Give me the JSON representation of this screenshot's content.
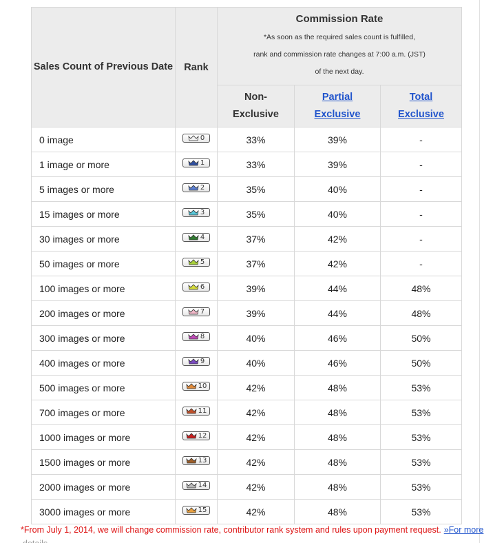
{
  "table": {
    "headers": {
      "sales_count": "Sales Count of Previous Date",
      "rank": "Rank",
      "commission_rate": "Commission Rate",
      "commission_note": [
        "*As soon as the required sales count is fulfilled,",
        "rank and commission rate changes at 7:00 a.m. (JST)",
        "of the next day."
      ],
      "non_exclusive": "Non- Exclusive",
      "partial_exclusive": "Partial Exclusive",
      "total_exclusive": "Total Exclusive"
    },
    "rows": [
      {
        "count": "0 image",
        "rank": "0",
        "rank_color": "#f2f2f2",
        "non_exclusive": "33%",
        "partial": "39%",
        "total": "-"
      },
      {
        "count": "1 image or more",
        "rank": "1",
        "rank_color": "#2f4fa0",
        "non_exclusive": "33%",
        "partial": "39%",
        "total": "-"
      },
      {
        "count": "5 images or more",
        "rank": "2",
        "rank_color": "#5b7fd1",
        "non_exclusive": "35%",
        "partial": "40%",
        "total": "-"
      },
      {
        "count": "15 images or more",
        "rank": "3",
        "rank_color": "#58c6d8",
        "non_exclusive": "35%",
        "partial": "40%",
        "total": "-"
      },
      {
        "count": "30 images or more",
        "rank": "4",
        "rank_color": "#2f7a2f",
        "non_exclusive": "37%",
        "partial": "42%",
        "total": "-"
      },
      {
        "count": "50 images or more",
        "rank": "5",
        "rank_color": "#a8d13a",
        "non_exclusive": "37%",
        "partial": "42%",
        "total": "-"
      },
      {
        "count": "100 images or more",
        "rank": "6",
        "rank_color": "#d6dc3a",
        "non_exclusive": "39%",
        "partial": "44%",
        "total": "48%"
      },
      {
        "count": "200 images or more",
        "rank": "7",
        "rank_color": "#f0b8c8",
        "non_exclusive": "39%",
        "partial": "44%",
        "total": "48%"
      },
      {
        "count": "300 images or more",
        "rank": "8",
        "rank_color": "#c04ab8",
        "non_exclusive": "40%",
        "partial": "46%",
        "total": "50%"
      },
      {
        "count": "400 images or more",
        "rank": "9",
        "rank_color": "#7a4ac0",
        "non_exclusive": "40%",
        "partial": "46%",
        "total": "50%"
      },
      {
        "count": "500 images or more",
        "rank": "10",
        "rank_color": "#e08a3a",
        "non_exclusive": "42%",
        "partial": "48%",
        "total": "53%"
      },
      {
        "count": "700 images or more",
        "rank": "11",
        "rank_color": "#c0502a",
        "non_exclusive": "42%",
        "partial": "48%",
        "total": "53%"
      },
      {
        "count": "1000 images or more",
        "rank": "12",
        "rank_color": "#c81e1e",
        "non_exclusive": "42%",
        "partial": "48%",
        "total": "53%"
      },
      {
        "count": "1500 images or more",
        "rank": "13",
        "rank_color": "#a0602a",
        "non_exclusive": "42%",
        "partial": "48%",
        "total": "53%"
      },
      {
        "count": "2000 images or more",
        "rank": "14",
        "rank_color": "#b8b8b8",
        "non_exclusive": "42%",
        "partial": "48%",
        "total": "53%"
      },
      {
        "count": "3000 images or more",
        "rank": "15",
        "rank_color": "#e8a040",
        "non_exclusive": "42%",
        "partial": "48%",
        "total": "53%"
      }
    ]
  },
  "footnote": {
    "text": "*From July 1, 2014, we will change commission rate, contributor rank system and rules upon payment request.",
    "link": "»For more",
    "tail": "details"
  },
  "colors": {
    "header_bg": "#ececec",
    "link": "#2255cc",
    "footnote": "#dd1111",
    "border": "#d8d8d8"
  }
}
